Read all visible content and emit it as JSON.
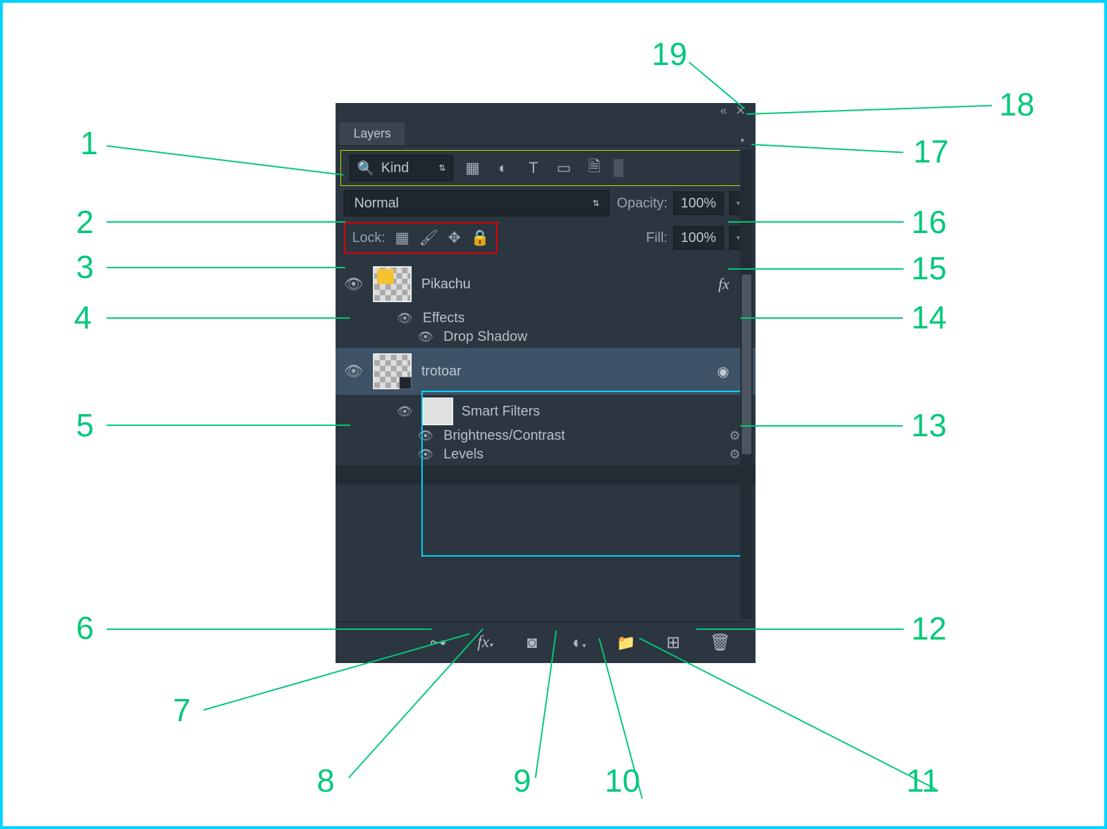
{
  "panel": {
    "tab_label": "Layers",
    "filter": {
      "kind_label": "Kind"
    },
    "blend": {
      "mode": "Normal",
      "opacity_label": "Opacity:",
      "opacity_value": "100%"
    },
    "lock": {
      "label": "Lock:",
      "fill_label": "Fill:",
      "fill_value": "100%"
    },
    "layers": [
      {
        "name": "Pikachu",
        "fx": "fx",
        "effects_label": "Effects",
        "effect_items": [
          "Drop Shadow"
        ]
      },
      {
        "name": "trotoar",
        "smart_label": "Smart Filters",
        "smart_items": [
          "Brightness/Contrast",
          "Levels"
        ]
      }
    ]
  },
  "annotations": {
    "1": "1",
    "2": "2",
    "3": "3",
    "4": "4",
    "5": "5",
    "6": "6",
    "7": "7",
    "8": "8",
    "9": "9",
    "10": "10",
    "11": "11",
    "12": "12",
    "13": "13",
    "14": "14",
    "15": "15",
    "16": "16",
    "17": "17",
    "18": "18",
    "19": "19"
  }
}
